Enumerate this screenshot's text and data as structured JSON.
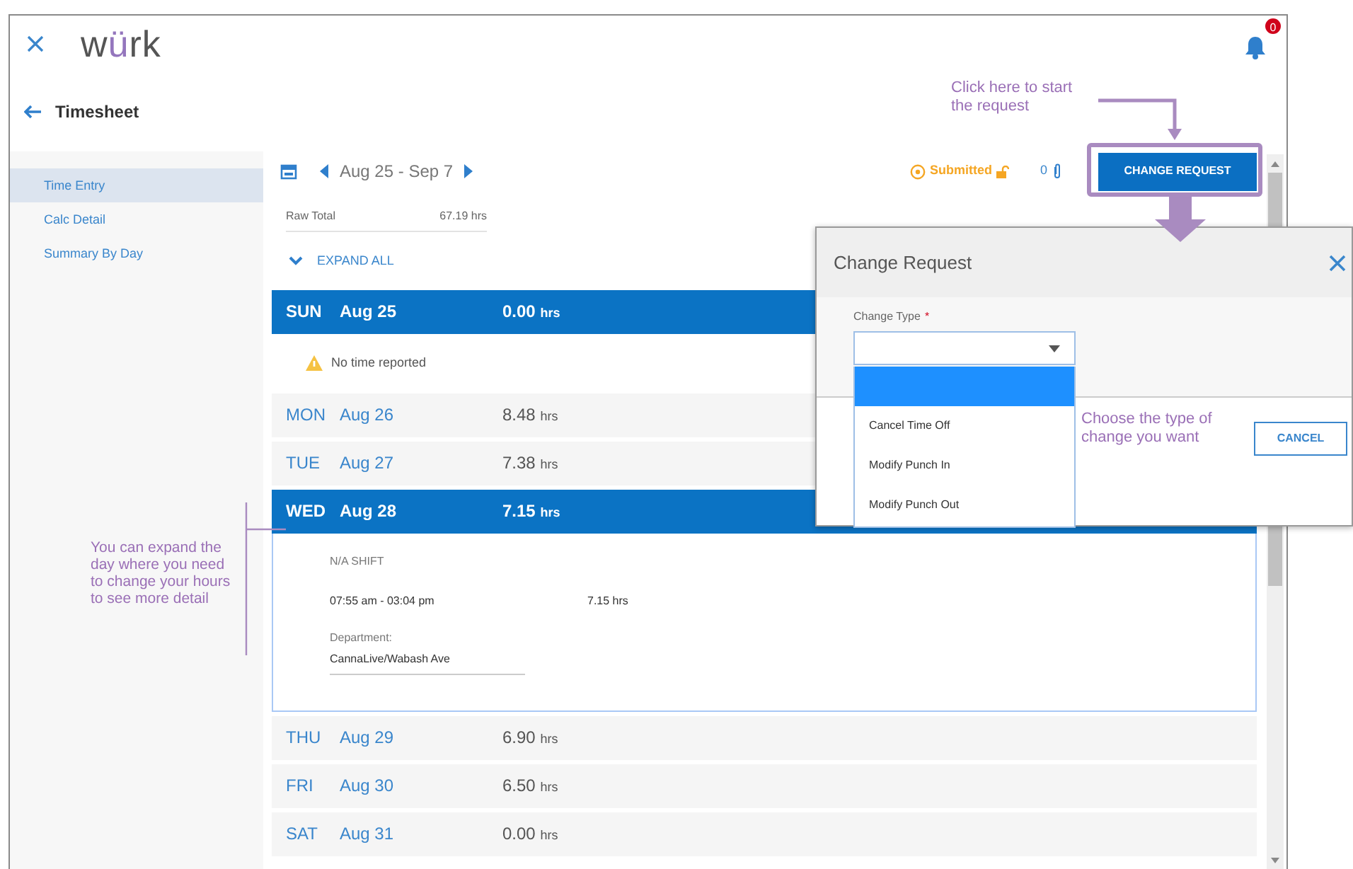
{
  "app": {
    "logo": "würk",
    "notification_count": "0",
    "page_title": "Timesheet"
  },
  "sidebar": {
    "items": [
      {
        "label": "Time Entry",
        "selected": true
      },
      {
        "label": "Calc Detail",
        "selected": false
      },
      {
        "label": "Summary By Day",
        "selected": false
      }
    ]
  },
  "toolbar": {
    "date_range": "Aug 25 - Sep 7",
    "status": "Submitted",
    "attachments": "0",
    "change_request_button": "CHANGE REQUEST"
  },
  "raw_total": {
    "label": "Raw Total",
    "value": "67.19 hrs"
  },
  "expand_all": "EXPAND ALL",
  "days": [
    {
      "day": "SUN",
      "date": "Aug 25",
      "hours": "0.00",
      "unit": "hrs",
      "selected": true,
      "detail": {
        "kind": "warning",
        "message": "No time reported"
      }
    },
    {
      "day": "MON",
      "date": "Aug 26",
      "hours": "8.48",
      "unit": "hrs",
      "selected": false
    },
    {
      "day": "TUE",
      "date": "Aug 27",
      "hours": "7.38",
      "unit": "hrs",
      "selected": false
    },
    {
      "day": "WED",
      "date": "Aug 28",
      "hours": "7.15",
      "unit": "hrs",
      "selected": true,
      "detail": {
        "kind": "shift",
        "shift": "N/A SHIFT",
        "time_range": "07:55 am - 03:04 pm",
        "hours": "7.15 hrs",
        "department_label": "Department:",
        "department": "CannaLive/Wabash Ave"
      }
    },
    {
      "day": "THU",
      "date": "Aug 29",
      "hours": "6.90",
      "unit": "hrs",
      "selected": false
    },
    {
      "day": "FRI",
      "date": "Aug 30",
      "hours": "6.50",
      "unit": "hrs",
      "selected": false
    },
    {
      "day": "SAT",
      "date": "Aug 31",
      "hours": "0.00",
      "unit": "hrs",
      "selected": false
    }
  ],
  "dialog": {
    "title": "Change Request",
    "field_label": "Change Type",
    "required_mark": "*",
    "options": [
      {
        "highlighted": true
      },
      {
        "label": "Cancel Time Off",
        "highlighted": false
      },
      {
        "label": "Modify Punch In",
        "highlighted": false
      },
      {
        "label": "Modify Punch Out",
        "highlighted": false
      }
    ],
    "cancel_button": "CANCEL"
  },
  "annotations": [
    {
      "kind": "top",
      "text": "Click here to start the request"
    },
    {
      "kind": "dialog",
      "text": "Choose the type of change you want"
    },
    {
      "kind": "left",
      "text": "You can expand the day where you need to change your hours to see more detail"
    }
  ]
}
